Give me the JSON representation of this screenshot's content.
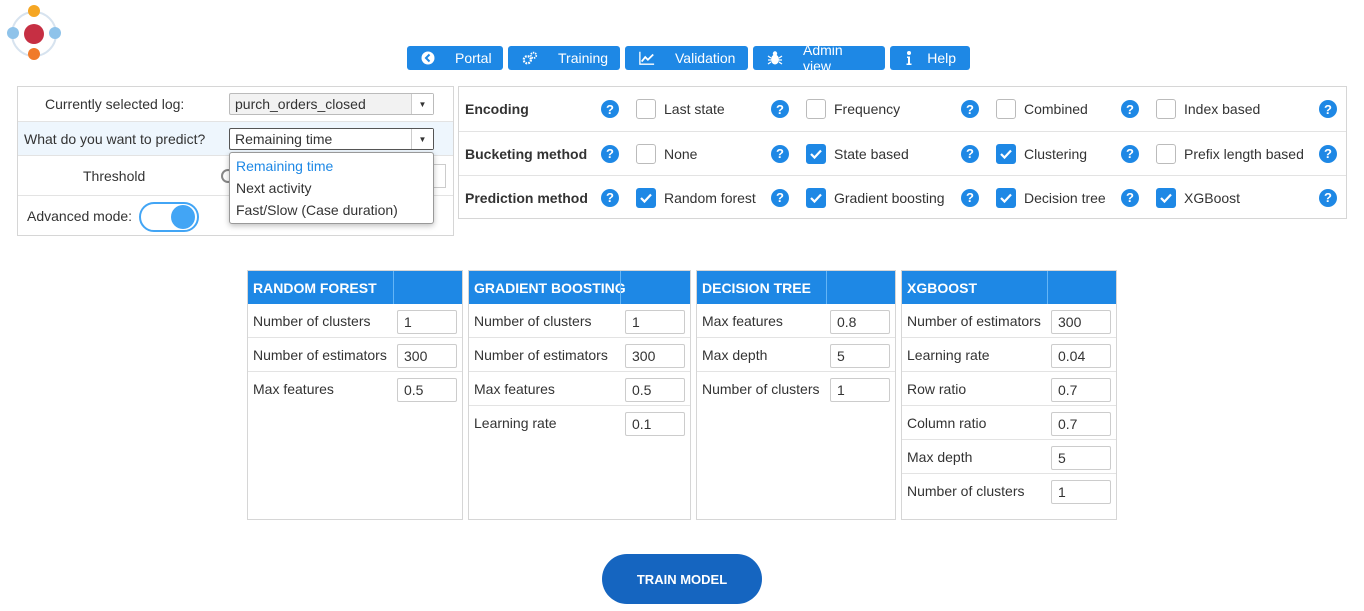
{
  "nav": [
    {
      "label": "Portal",
      "icon": "arrow-left-circle-icon"
    },
    {
      "label": "Training",
      "icon": "gears-icon"
    },
    {
      "label": "Validation",
      "icon": "line-chart-icon"
    },
    {
      "label": "Admin view",
      "icon": "bug-icon"
    },
    {
      "label": "Help",
      "icon": "info-icon"
    }
  ],
  "left_panel": {
    "log_label": "Currently selected log:",
    "log_value": "purch_orders_closed",
    "predict_label": "What do you want to predict?",
    "predict_value": "Remaining time",
    "threshold_label": "Threshold",
    "advanced_label": "Advanced mode:",
    "dropdown_options": [
      "Remaining time",
      "Next activity",
      "Fast/Slow (Case duration)"
    ]
  },
  "config": {
    "encoding": {
      "title": "Encoding",
      "options": [
        {
          "label": "Last state",
          "checked": false
        },
        {
          "label": "Frequency",
          "checked": false
        },
        {
          "label": "Combined",
          "checked": false
        },
        {
          "label": "Index based",
          "checked": false
        }
      ]
    },
    "bucketing": {
      "title": "Bucketing method",
      "options": [
        {
          "label": "None",
          "checked": false
        },
        {
          "label": "State based",
          "checked": true
        },
        {
          "label": "Clustering",
          "checked": true
        },
        {
          "label": "Prefix length based",
          "checked": false
        }
      ]
    },
    "prediction": {
      "title": "Prediction method",
      "options": [
        {
          "label": "Random forest",
          "checked": true
        },
        {
          "label": "Gradient boosting",
          "checked": true
        },
        {
          "label": "Decision tree",
          "checked": true
        },
        {
          "label": "XGBoost",
          "checked": true
        }
      ]
    }
  },
  "tables": [
    {
      "title": "RANDOM FOREST",
      "rows": [
        {
          "label": "Number of clusters",
          "value": "1"
        },
        {
          "label": "Number of estimators",
          "value": "300"
        },
        {
          "label": "Max features",
          "value": "0.5"
        }
      ]
    },
    {
      "title": "GRADIENT BOOSTING",
      "rows": [
        {
          "label": "Number of clusters",
          "value": "1"
        },
        {
          "label": "Number of estimators",
          "value": "300"
        },
        {
          "label": "Max features",
          "value": "0.5"
        },
        {
          "label": "Learning rate",
          "value": "0.1"
        }
      ]
    },
    {
      "title": "DECISION TREE",
      "rows": [
        {
          "label": "Max features",
          "value": "0.8"
        },
        {
          "label": "Max depth",
          "value": "5"
        },
        {
          "label": "Number of clusters",
          "value": "1"
        }
      ]
    },
    {
      "title": "XGBOOST",
      "rows": [
        {
          "label": "Number of estimators",
          "value": "300"
        },
        {
          "label": "Learning rate",
          "value": "0.04"
        },
        {
          "label": "Row ratio",
          "value": "0.7"
        },
        {
          "label": "Column ratio",
          "value": "0.7"
        },
        {
          "label": "Max depth",
          "value": "5"
        },
        {
          "label": "Number of clusters",
          "value": "1"
        }
      ]
    }
  ],
  "train_label": "TRAIN MODEL",
  "help_glyph": "?",
  "colors": {
    "accent": "#1e88e5",
    "train": "#1565c0",
    "header": "#1e88e5"
  }
}
